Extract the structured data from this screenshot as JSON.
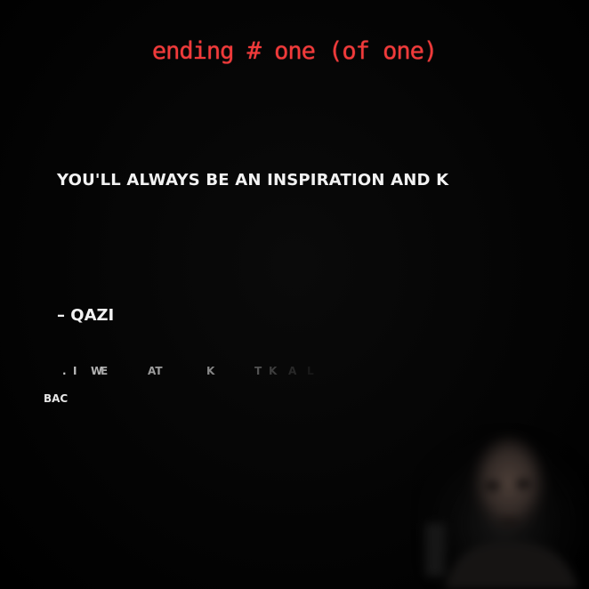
{
  "ending": {
    "title": "ending # one (of one)"
  },
  "quote": {
    "text": "YOU'LL ALWAYS BE AN INSPIRATION AND K",
    "signature": "– QAZI"
  },
  "fading_fragments": [
    {
      "text": ".",
      "opacity": 0.9
    },
    {
      "text": "I",
      "opacity": 0.85
    },
    {
      "text": "W",
      "opacity": 0.8
    },
    {
      "text": "E",
      "opacity": 0.75
    },
    {
      "text": "AT",
      "opacity": 0.7
    },
    {
      "text": "K",
      "opacity": 0.6
    },
    {
      "text": "T",
      "opacity": 0.35
    },
    {
      "text": "K",
      "opacity": 0.25
    },
    {
      "text": "A",
      "opacity": 0.15
    },
    {
      "text": "L",
      "opacity": 0.08
    }
  ],
  "navigation": {
    "back_label": "BAC"
  },
  "colors": {
    "title": "#f23a3a",
    "text": "#f2f2f2",
    "background": "#000000"
  }
}
